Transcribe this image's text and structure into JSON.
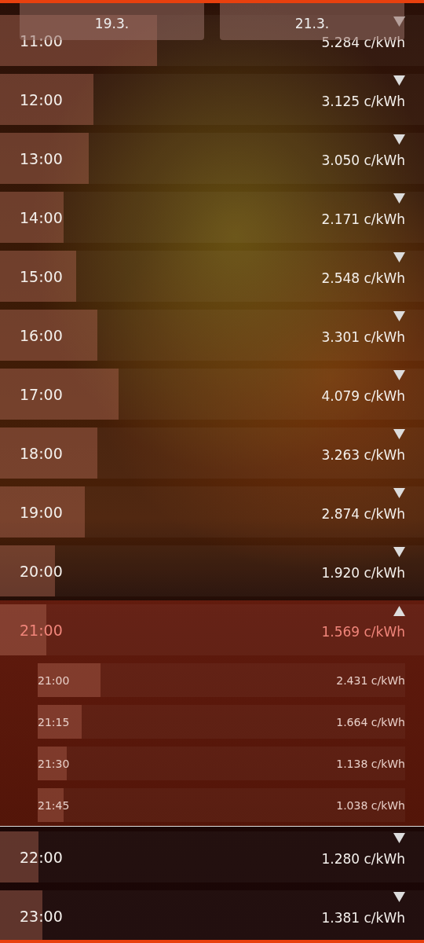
{
  "date_tabs": [
    {
      "label": "19.3."
    },
    {
      "label": "21.3."
    }
  ],
  "hours": [
    {
      "time": "11:00",
      "price": "5.284 c/kWh",
      "level": 0.37,
      "expanded": false
    },
    {
      "time": "12:00",
      "price": "3.125 c/kWh",
      "level": 0.22,
      "expanded": false
    },
    {
      "time": "13:00",
      "price": "3.050 c/kWh",
      "level": 0.21,
      "expanded": false
    },
    {
      "time": "14:00",
      "price": "2.171 c/kWh",
      "level": 0.15,
      "expanded": false
    },
    {
      "time": "15:00",
      "price": "2.548 c/kWh",
      "level": 0.18,
      "expanded": false
    },
    {
      "time": "16:00",
      "price": "3.301 c/kWh",
      "level": 0.23,
      "expanded": false
    },
    {
      "time": "17:00",
      "price": "4.079 c/kWh",
      "level": 0.28,
      "expanded": false
    },
    {
      "time": "18:00",
      "price": "3.263 c/kWh",
      "level": 0.23,
      "expanded": false
    },
    {
      "time": "19:00",
      "price": "2.874 c/kWh",
      "level": 0.2,
      "expanded": false
    },
    {
      "time": "20:00",
      "price": "1.920 c/kWh",
      "level": 0.13,
      "expanded": false
    },
    {
      "time": "21:00",
      "price": "1.569 c/kWh",
      "level": 0.11,
      "expanded": true,
      "quarters": [
        {
          "time": "21:00",
          "price": "2.431 c/kWh",
          "level": 0.17
        },
        {
          "time": "21:15",
          "price": "1.664 c/kWh",
          "level": 0.12
        },
        {
          "time": "21:30",
          "price": "1.138 c/kWh",
          "level": 0.08
        },
        {
          "time": "21:45",
          "price": "1.038 c/kWh",
          "level": 0.07
        }
      ]
    },
    {
      "time": "22:00",
      "price": "1.280 c/kWh",
      "level": 0.09,
      "expanded": false
    },
    {
      "time": "23:00",
      "price": "1.381 c/kWh",
      "level": 0.1,
      "expanded": false
    }
  ]
}
